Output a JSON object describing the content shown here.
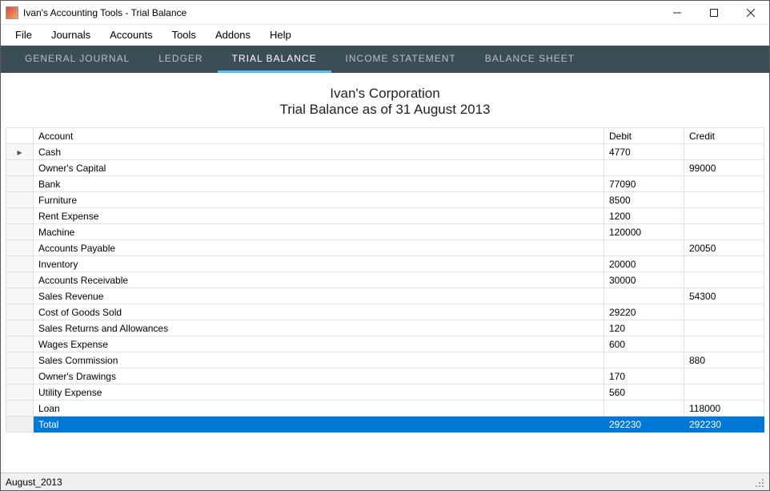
{
  "window": {
    "title": "Ivan's Accounting Tools - Trial Balance"
  },
  "menu": {
    "items": [
      "File",
      "Journals",
      "Accounts",
      "Tools",
      "Addons",
      "Help"
    ]
  },
  "tabs": {
    "items": [
      "GENERAL JOURNAL",
      "LEDGER",
      "TRIAL BALANCE",
      "INCOME STATEMENT",
      "BALANCE SHEET"
    ],
    "active_index": 2
  },
  "report": {
    "company": "Ivan's Corporation",
    "subtitle": "Trial Balance as of 31 August 2013"
  },
  "grid": {
    "columns": [
      "Account",
      "Debit",
      "Credit"
    ],
    "rows": [
      {
        "account": "Cash",
        "debit": "4770",
        "credit": ""
      },
      {
        "account": "Owner's Capital",
        "debit": "",
        "credit": "99000"
      },
      {
        "account": "Bank",
        "debit": "77090",
        "credit": ""
      },
      {
        "account": "Furniture",
        "debit": "8500",
        "credit": ""
      },
      {
        "account": "Rent Expense",
        "debit": "1200",
        "credit": ""
      },
      {
        "account": "Machine",
        "debit": "120000",
        "credit": ""
      },
      {
        "account": "Accounts Payable",
        "debit": "",
        "credit": "20050"
      },
      {
        "account": "Inventory",
        "debit": "20000",
        "credit": ""
      },
      {
        "account": "Accounts Receivable",
        "debit": "30000",
        "credit": ""
      },
      {
        "account": "Sales Revenue",
        "debit": "",
        "credit": "54300"
      },
      {
        "account": "Cost of Goods Sold",
        "debit": "29220",
        "credit": ""
      },
      {
        "account": "Sales Returns and Allowances",
        "debit": "120",
        "credit": ""
      },
      {
        "account": "Wages Expense",
        "debit": "600",
        "credit": ""
      },
      {
        "account": "Sales Commission",
        "debit": "",
        "credit": "880"
      },
      {
        "account": "Owner's Drawings",
        "debit": "170",
        "credit": ""
      },
      {
        "account": "Utility Expense",
        "debit": "560",
        "credit": ""
      },
      {
        "account": "Loan",
        "debit": "",
        "credit": "118000"
      },
      {
        "account": "Total",
        "debit": "292230",
        "credit": "292230",
        "is_total": true
      }
    ]
  },
  "status": {
    "text": "August_2013"
  }
}
